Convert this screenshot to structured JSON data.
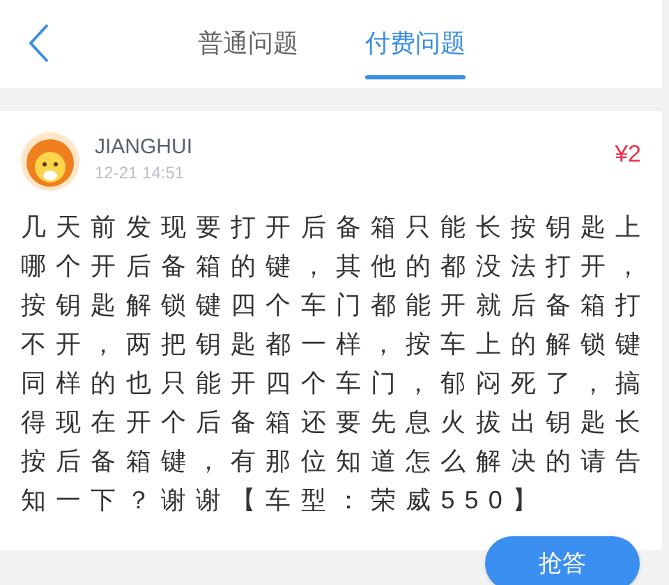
{
  "tabs": [
    {
      "label": "普通问题",
      "selected": false
    },
    {
      "label": "付费问题",
      "selected": true
    }
  ],
  "question": {
    "user": "JIANGHUI",
    "time": "12-21 14:51",
    "reward": "¥2",
    "body": "几天前发现要打开后备箱只能长按钥匙上哪个开后备箱的键，其他的都没法打开，按钥匙解锁键四个车门都能开就后备箱打不开，两把钥匙都一样，按车上的解锁键同样的也只能开四个车门，郁闷死了，搞得现在开个后备箱还要先息火拔出钥匙长按后备箱键，有那位知道怎么解决的请告知一下？谢谢【车型：荣威550】",
    "button": "抢答"
  }
}
